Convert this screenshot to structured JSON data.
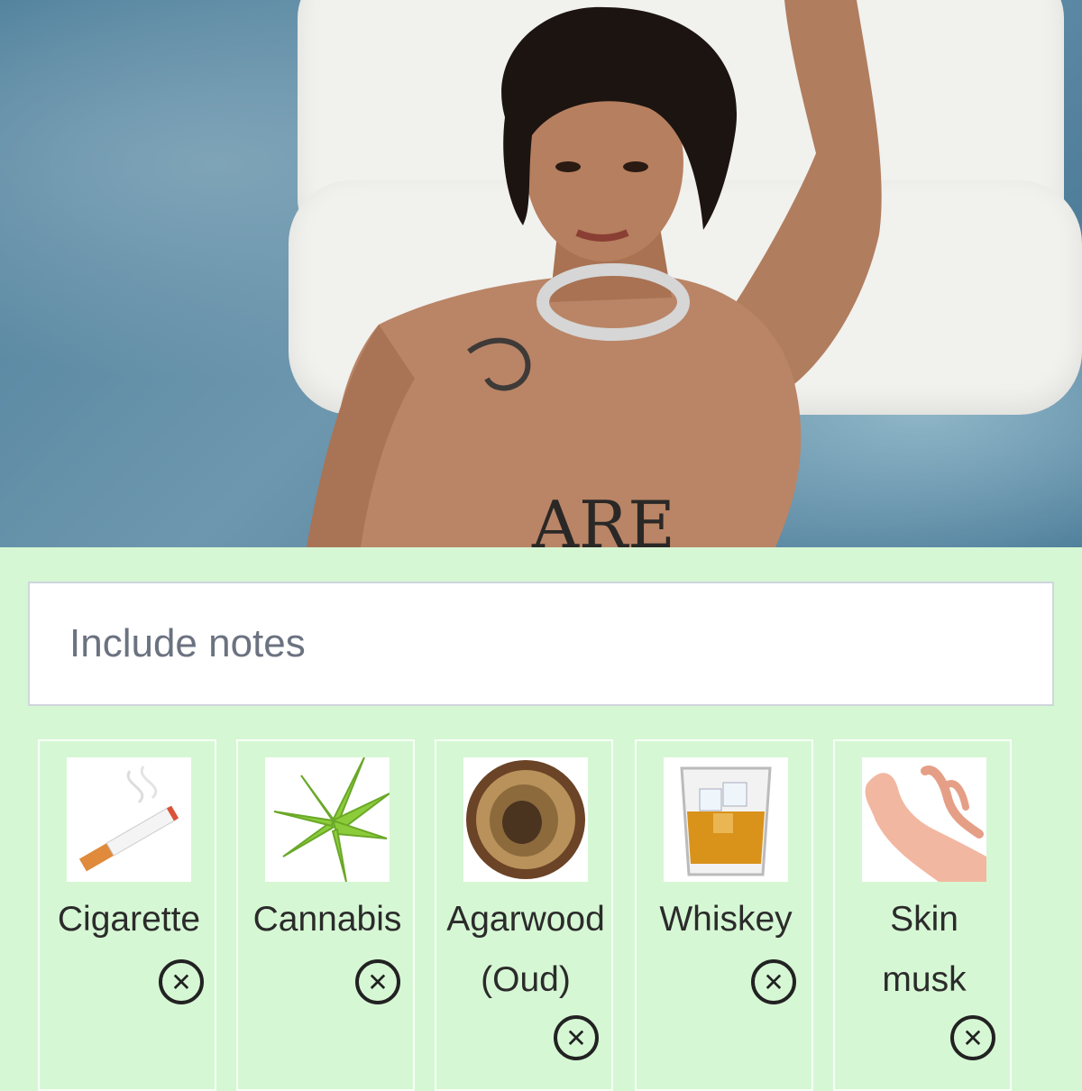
{
  "search": {
    "placeholder": "Include notes"
  },
  "notes": [
    {
      "label": "Cigarette",
      "icon": "cigarette-icon"
    },
    {
      "label": "Cannabis",
      "icon": "cannabis-leaf-icon"
    },
    {
      "label": "Agarwood\n(Oud)",
      "icon": "agarwood-icon"
    },
    {
      "label": "Whiskey",
      "icon": "whiskey-glass-icon"
    },
    {
      "label": "Skin\nmusk",
      "icon": "hand-icon"
    }
  ],
  "colors": {
    "panel": "#d6f7d4",
    "card_border": "#f6fff6"
  }
}
